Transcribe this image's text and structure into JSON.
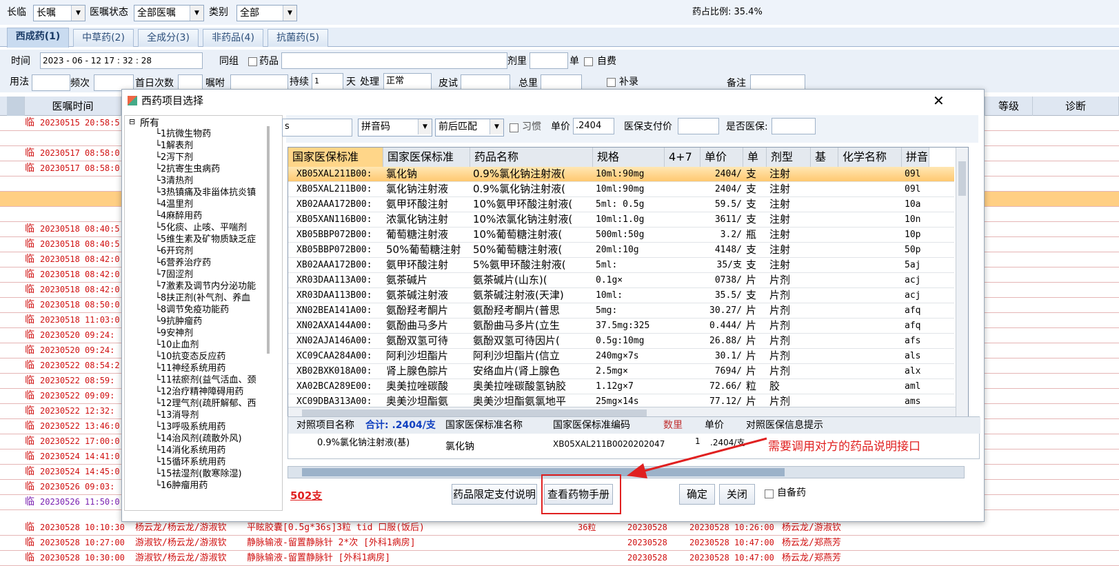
{
  "topbar": {
    "label_longtemp": "长临",
    "longtemp_value": "长嘱",
    "label_status": "医嘱状态",
    "status_value": "全部医嘱",
    "label_type": "类别",
    "type_value": "全部",
    "drug_ratio": "药占比例: 35.4%"
  },
  "tabs": [
    "西成药(1)",
    "中草药(2)",
    "全成分(3)",
    "非药品(4)",
    "抗菌药(5)"
  ],
  "form": {
    "time_label": "时间",
    "time_value": "2023 - 06 - 12    17 : 32 : 28",
    "group_label": "同组",
    "drug_label": "药品",
    "dose_label": "剂里",
    "unit_label": "单",
    "selfpay_label": "自费",
    "usage_label": "用法",
    "freq_label": "频次",
    "first_label": "首日次数",
    "note_label": "嘱咐",
    "duration_label": "持续",
    "duration_value": "1",
    "day_label": "天",
    "process_label": "处理",
    "process_value": "正常",
    "skin_label": "皮试",
    "total_label": "总里",
    "supp_label": "补录",
    "remark_label": "备注"
  },
  "grid_headers": [
    "医嘱时间",
    "等级",
    "诊断"
  ],
  "bg_rows": [
    {
      "t": "临",
      "time": "20230515 20:58:5",
      "cls": "red"
    },
    {
      "t": "",
      "time": "",
      "cls": "red"
    },
    {
      "t": "临",
      "time": "20230517 08:58:0",
      "cls": "red"
    },
    {
      "t": "临",
      "time": "20230517 08:58:0",
      "cls": "red"
    },
    {
      "t": "",
      "time": "",
      "cls": "red"
    },
    {
      "t": "",
      "time": "",
      "cls": "orange"
    },
    {
      "t": "",
      "time": "",
      "cls": "red"
    },
    {
      "t": "临",
      "time": "20230518 08:40:5",
      "cls": "red"
    },
    {
      "t": "临",
      "time": "20230518 08:40:5",
      "cls": "red"
    },
    {
      "t": "临",
      "time": "20230518 08:42:0",
      "cls": "red"
    },
    {
      "t": "临",
      "time": "20230518 08:42:0",
      "cls": "red"
    },
    {
      "t": "临",
      "time": "20230518 08:42:0",
      "cls": "red"
    },
    {
      "t": "临",
      "time": "20230518 08:50:0",
      "cls": "red"
    },
    {
      "t": "临",
      "time": "20230518 11:03:0",
      "cls": "red"
    },
    {
      "t": "临",
      "time": "20230520 09:24:",
      "cls": "red"
    },
    {
      "t": "临",
      "time": "20230520 09:24:",
      "cls": "red"
    },
    {
      "t": "临",
      "time": "20230522 08:54:2",
      "cls": "red"
    },
    {
      "t": "临",
      "time": "20230522 08:59:",
      "cls": "red"
    },
    {
      "t": "临",
      "time": "20230522 09:09:",
      "cls": "red"
    },
    {
      "t": "临",
      "time": "20230522 12:32:",
      "cls": "red"
    },
    {
      "t": "临",
      "time": "20230522 13:46:0",
      "cls": "red"
    },
    {
      "t": "临",
      "time": "20230522 17:00:0",
      "cls": "red"
    },
    {
      "t": "临",
      "time": "20230524 14:41:0",
      "cls": "red"
    },
    {
      "t": "临",
      "time": "20230524 14:45:0",
      "cls": "red"
    },
    {
      "t": "临",
      "time": "20230526 09:03:",
      "cls": "red"
    },
    {
      "t": "临",
      "time": "20230526 11:50:0",
      "cls": "purple"
    }
  ],
  "bottom_rows": [
    {
      "t": "临",
      "time": "20230528 10:10:30",
      "doc": "杨云龙/杨云龙/游淑钦",
      "content": "平眩胶囊[0.5g*36s]3粒  tid 口服(饭后)",
      "qty": "36粒",
      "date": "20230528",
      "exec": "20230528 10:26:00",
      "nurse": "杨云龙/游淑钦"
    },
    {
      "t": "临",
      "time": "20230528 10:27:00",
      "doc": "游淑钦/杨云龙/游淑钦",
      "content": "静脉输液-留置静脉针  2*次  [外科1病房]",
      "qty": "",
      "date": "20230528",
      "exec": "20230528 10:47:00",
      "nurse": "杨云龙/郑燕芳"
    },
    {
      "t": "临",
      "time": "20230528 10:30:00",
      "doc": "游淑钦/杨云龙/游淑钦",
      "content": "静脉输液-留置静脉针  [外科1病房]",
      "qty": "",
      "date": "20230528",
      "exec": "20230528 10:47:00",
      "nurse": "杨云龙/郑燕芳"
    }
  ],
  "dialog": {
    "title": "西药项目选择",
    "search_value": "s",
    "match_type": "拼音码",
    "match_mode": "前后匹配",
    "habit_label": "习惯",
    "price_label": "单价",
    "price_value": ".2404",
    "insurance_price_label": "医保支付价",
    "is_insurance_label": "是否医保:",
    "tree_root": "所有",
    "tree_items": [
      "1抗微生物药",
      "1解表剂",
      "2泻下剂",
      "2抗寄生虫病药",
      "3清热剂",
      "3热镇痛及非甾体抗炎镇",
      "4温里剂",
      "4麻醉用药",
      "5化痰、止咳、平喘剂",
      "5维生素及矿物质缺乏症",
      "6开窍剂",
      "6营养治疗药",
      "7固涩剂",
      "7激素及调节内分泌功能",
      "8扶正剂(补气剂、养血",
      "8调节免疫功能药",
      "9抗肿瘤药",
      "9安神剂",
      "10止血剂",
      "10抗变态反应药",
      "11神经系统用药",
      "11祛瘀剂(益气活血、颈",
      "12治疗精神障碍用药",
      "12理气剂(疏肝解郁、西",
      "13消导剂",
      "13呼吸系统用药",
      "14治风剂(疏散外风)",
      "14消化系统用药",
      "15循环系统用药",
      "15祛湿剂(散寒除湿)",
      "16肿瘤用药"
    ],
    "grid_headers": [
      "国家医保标准",
      "国家医保标准",
      "药品名称",
      "规格",
      "4+7",
      "单价",
      "单",
      "剂型",
      "基",
      "化学名称",
      "拼音"
    ],
    "rows": [
      [
        "XB05XAL211B00:",
        "氯化钠",
        "0.9%氯化钠注射液(",
        "10ml:90mg",
        "",
        "2404/",
        "支",
        "注射",
        "",
        "",
        "09l"
      ],
      [
        "XB05XAL211B00:",
        "氯化钠注射液",
        "0.9%氯化钠注射液(",
        "10ml:90mg",
        "",
        "2404/",
        "支",
        "注射",
        "",
        "",
        "09l"
      ],
      [
        "XB02AAA172B00:",
        "氨甲环酸注射",
        "10%氨甲环酸注射液(",
        "5ml: 0.5g",
        "",
        "59.5/",
        "支",
        "注射",
        "",
        "",
        "10a"
      ],
      [
        "XB05XAN116B00:",
        "浓氯化钠注射",
        "10%浓氯化钠注射液(",
        "10ml:1.0g",
        "",
        "3611/",
        "支",
        "注射",
        "",
        "",
        "10n"
      ],
      [
        "XB05BBP072B00:",
        "葡萄糖注射液",
        "10%葡萄糖注射液(",
        "500ml:50g",
        "",
        "3.2/",
        "瓶",
        "注射",
        "",
        "",
        "10p"
      ],
      [
        "XB05BBP072B00:",
        "50%葡萄糖注射",
        "50%葡萄糖注射液(",
        "20ml:10g",
        "",
        "4148/",
        "支",
        "注射",
        "",
        "",
        "50p"
      ],
      [
        "XB02AAA172B00:",
        "氨甲环酸注射",
        "5%氨甲环酸注射液(",
        "5ml:",
        "",
        "35/支",
        "支",
        "注射",
        "",
        "",
        "5aj"
      ],
      [
        "XR03DAA113A00:",
        "氨茶碱片",
        "氨茶碱片(山东)(",
        "0.1g×",
        "",
        "0738/",
        "片",
        "片剂",
        "",
        "",
        "acj"
      ],
      [
        "XR03DAA113B00:",
        "氨茶碱注射液",
        "氨茶碱注射液(天津)",
        "10ml:",
        "",
        "35.5/",
        "支",
        "片剂",
        "",
        "",
        "acj"
      ],
      [
        "XN02BEA141A00:",
        "氨酚羟考酮片",
        "氨酚羟考酮片(普思",
        "5mg:",
        "",
        "30.27/",
        "片",
        "片剂",
        "",
        "",
        "afq"
      ],
      [
        "XN02AXA144A00:",
        "氨酚曲马多片",
        "氨酚曲马多片(立生",
        "37.5mg:325",
        "",
        "0.444/",
        "片",
        "片剂",
        "",
        "",
        "afq"
      ],
      [
        "XN02AJA146A00:",
        "氨酚双氢可待",
        "氨酚双氢可待因片(",
        "0.5g:10mg",
        "",
        "26.88/",
        "片",
        "片剂",
        "",
        "",
        "afs"
      ],
      [
        "XC09CAA284A00:",
        "阿利沙坦酯片",
        "阿利沙坦酯片(信立",
        "240mg×7s",
        "",
        "30.1/",
        "片",
        "片剂",
        "",
        "",
        "als"
      ],
      [
        "XB02BXK018A00:",
        "肾上腺色腙片",
        "安络血片(肾上腺色",
        "2.5mg×",
        "",
        "7694/",
        "片",
        "片剂",
        "",
        "",
        "alx"
      ],
      [
        "XA02BCA289E00:",
        "奥美拉唑碳酸",
        "奥美拉唑碳酸氢钠胶",
        "1.12g×7",
        "",
        "72.66/",
        "粒",
        "胶",
        "",
        "",
        "aml"
      ],
      [
        "XC09DBA313A00:",
        "奥美沙坦酯氨",
        "奥美沙坦酯氨氯地平",
        "25mg×14s",
        "",
        "77.12/",
        "片",
        "片剂",
        "",
        "",
        "ams"
      ]
    ],
    "detail_headers": [
      "对照项目名称",
      "合计: .2404/支",
      "国家医保标准名称",
      "国家医保标准编码",
      "数里",
      "单价",
      "对照医保信息提示"
    ],
    "detail_row": {
      "name": "0.9%氯化钠注射液(基)",
      "std_name": "氯化钠",
      "std_code": "XB05XAL211B0020202047",
      "qty": "1",
      "price": ".2404/支"
    },
    "annotation": "需要调用对方的药品说明接口",
    "count": "502支",
    "btn_limit": "药品限定支付说明",
    "btn_manual": "查看药物手册",
    "btn_ok": "确定",
    "btn_close": "关闭",
    "reserve_label": "自备药",
    "colors": {
      "annotation": "#e02020",
      "selected_row": "#ffd27f",
      "header_bg": "#e4e9ef"
    }
  }
}
